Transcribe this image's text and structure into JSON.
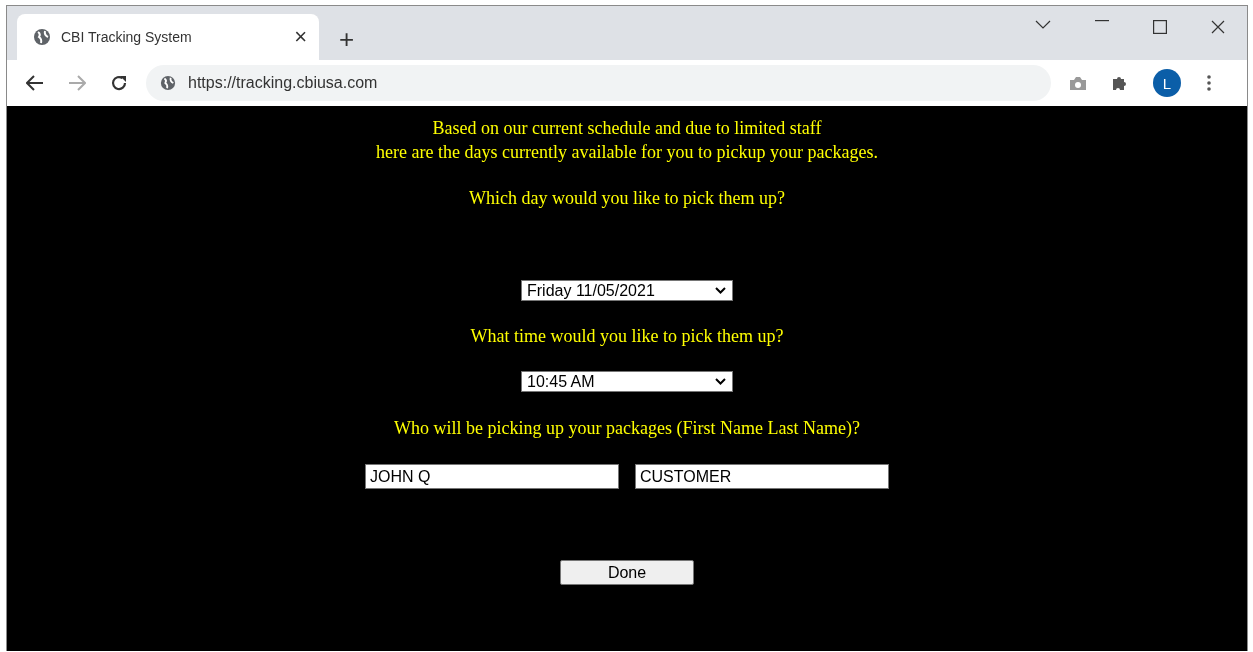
{
  "browser": {
    "tab": {
      "title": "CBI Tracking System",
      "close": "×",
      "new_tab": "+"
    },
    "address": "https://tracking.cbiusa.com",
    "profile": "L"
  },
  "page": {
    "intro": [
      "Based on our current schedule and due to limited staff",
      "here are the days currently available for you to pickup your packages."
    ],
    "day_question": "Which day would you like to pick them up?",
    "day": "Friday 11/05/2021",
    "time_question": "What time would you like to pick them up?",
    "time": "10:45 AM",
    "name_question": "Who will be picking up your packages (First Name Last Name)?",
    "first_name": "JOHN Q",
    "last_name": "CUSTOMER",
    "button": "Done"
  }
}
